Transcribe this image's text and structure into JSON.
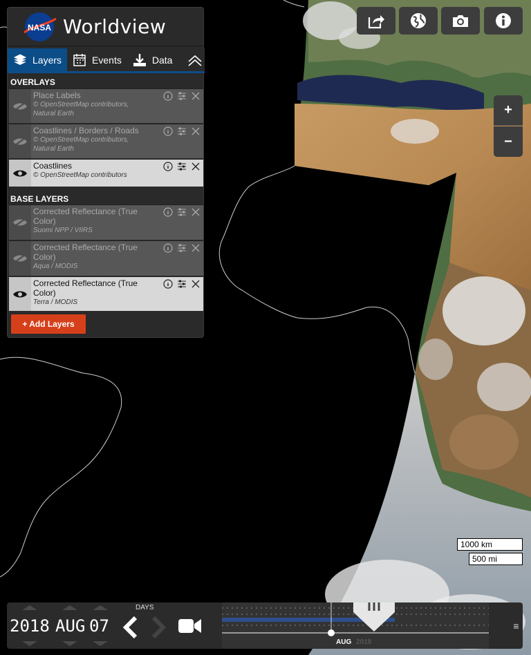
{
  "app": {
    "agency": "NASA",
    "title": "Worldview"
  },
  "tabs": [
    {
      "label": "Layers",
      "icon": "layers-icon"
    },
    {
      "label": "Events",
      "icon": "calendar-icon"
    },
    {
      "label": "Data",
      "icon": "download-icon"
    }
  ],
  "overlays": {
    "title": "OVERLAYS",
    "layers": [
      {
        "name": "Place Labels",
        "sub1": "© OpenStreetMap contributors,",
        "sub2": "Natural Earth",
        "visible": false
      },
      {
        "name": "Coastlines / Borders / Roads",
        "sub1": "© OpenStreetMap contributors,",
        "sub2": "Natural Earth",
        "visible": false
      },
      {
        "name": "Coastlines",
        "sub1": "© OpenStreetMap contributors",
        "sub2": "",
        "visible": true
      }
    ]
  },
  "base_layers": {
    "title": "BASE LAYERS",
    "layers": [
      {
        "name": "Corrected Reflectance (True Color)",
        "sub1": "Suomi NPP / VIIRS",
        "visible": false
      },
      {
        "name": "Corrected Reflectance (True Color)",
        "sub1": "Aqua / MODIS",
        "visible": false
      },
      {
        "name": "Corrected Reflectance (True Color)",
        "sub1": "Terra / MODIS",
        "visible": true
      }
    ]
  },
  "add_layers_label": "+ Add Layers",
  "zoom": {
    "in": "+",
    "out": "−"
  },
  "scale": {
    "km": "1000 km",
    "mi": "500 mi"
  },
  "timeline": {
    "year": "2018",
    "month": "AUG",
    "day": "07",
    "interval": "DAYS",
    "axis_month": "AUG",
    "axis_year": "2018",
    "menu": "≡"
  },
  "colors": {
    "accent": "#0b4d87",
    "add_button": "#d5401b",
    "panel": "#2a2a2a"
  }
}
